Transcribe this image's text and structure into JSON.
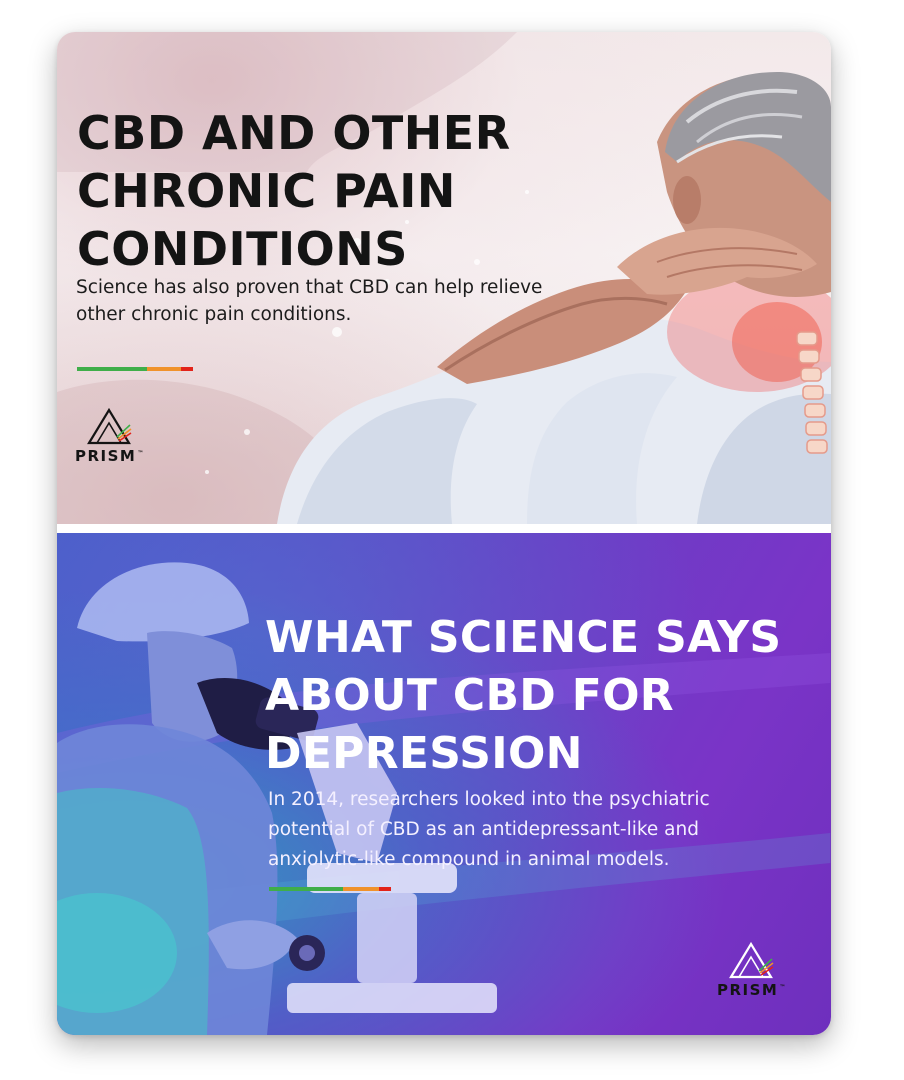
{
  "top_section": {
    "title": "CBD AND OTHER\nCHRONIC PAIN\nCONDITIONS",
    "text": "Science has also proven that CBD can help relieve other chronic pain conditions.",
    "logo_text": "PRISM",
    "logo_trademark": "™",
    "logo_icon": "prism-triangle-icon",
    "illustration": "person-holding-neck-illustration"
  },
  "bottom_section": {
    "title": "WHAT SCIENCE SAYS\nABOUT CBD FOR\nDEPRESSION",
    "text": "In 2014, researchers looked into the psychiatric potential of CBD as an antidepressant-like and anxiolytic-like compound in animal models.",
    "logo_text": "PRISM",
    "logo_trademark": "™",
    "logo_icon": "prism-triangle-icon",
    "illustration": "researcher-with-microscope-illustration"
  },
  "colors": {
    "accent_green": "#3fae49",
    "accent_orange": "#f0922b",
    "accent_red": "#e2231a",
    "bottom_panel_purple": "#7a34c7",
    "bottom_panel_teal": "#2aa9bd"
  }
}
